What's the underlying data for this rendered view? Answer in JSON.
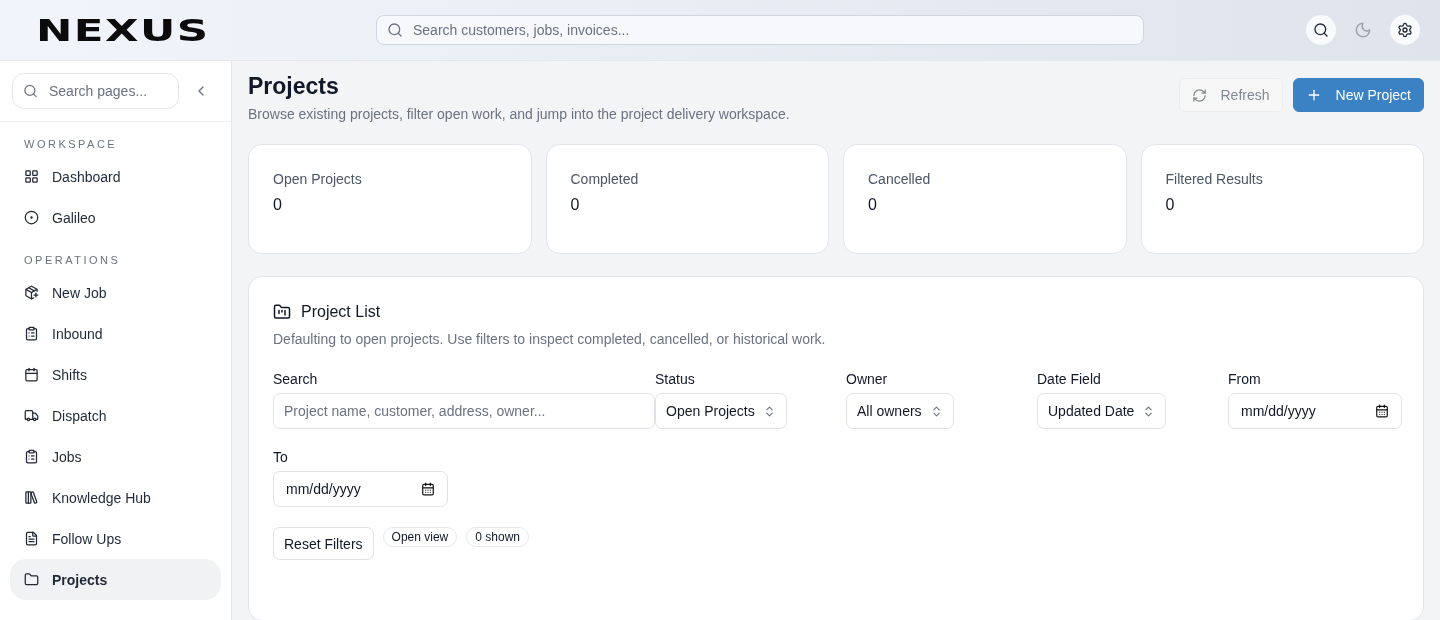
{
  "header": {
    "logo": "NEXUS",
    "search": {
      "placeholder": "Search customers, jobs, invoices..."
    }
  },
  "sidebar": {
    "search": {
      "placeholder": "Search pages..."
    },
    "sections": [
      {
        "title": "WORKSPACE",
        "items": [
          {
            "label": "Dashboard",
            "selected": false
          },
          {
            "label": "Galileo",
            "selected": false
          }
        ]
      },
      {
        "title": "OPERATIONS",
        "items": [
          {
            "label": "New Job",
            "selected": false
          },
          {
            "label": "Inbound",
            "selected": false
          },
          {
            "label": "Shifts",
            "selected": false
          },
          {
            "label": "Dispatch",
            "selected": false
          },
          {
            "label": "Jobs",
            "selected": false
          },
          {
            "label": "Knowledge Hub",
            "selected": false
          },
          {
            "label": "Follow Ups",
            "selected": false
          },
          {
            "label": "Projects",
            "selected": true
          }
        ]
      }
    ]
  },
  "page": {
    "title": "Projects",
    "subtitle": "Browse existing projects, filter open work, and jump into the project delivery workspace.",
    "buttons": [
      {
        "label": "Refresh",
        "kind": "secondary",
        "disabled": true
      },
      {
        "label": "New Project",
        "kind": "primary",
        "disabled": false
      }
    ]
  },
  "stats": [
    {
      "label": "Open Projects",
      "value": "0"
    },
    {
      "label": "Completed",
      "value": "0"
    },
    {
      "label": "Cancelled",
      "value": "0"
    },
    {
      "label": "Filtered Results",
      "value": "0"
    }
  ],
  "project_list": {
    "title": "Project List",
    "description": "Defaulting to open projects. Use filters to inspect completed, cancelled, or historical work.",
    "filters": [
      {
        "label": "Search",
        "kind": "text",
        "placeholder": "Project name, customer, address, owner..."
      },
      {
        "label": "Status",
        "kind": "select",
        "value": "Open Projects"
      },
      {
        "label": "Owner",
        "kind": "select",
        "value": "All owners"
      },
      {
        "label": "Date Field",
        "kind": "select",
        "value": "Updated Date"
      },
      {
        "label": "From",
        "kind": "date",
        "value": "mm/dd/yyyy"
      },
      {
        "label": "To",
        "kind": "date",
        "value": "mm/dd/yyyy"
      }
    ],
    "reset_button": "Reset Filters",
    "badges": [
      "Open view",
      "0 shown"
    ]
  }
}
